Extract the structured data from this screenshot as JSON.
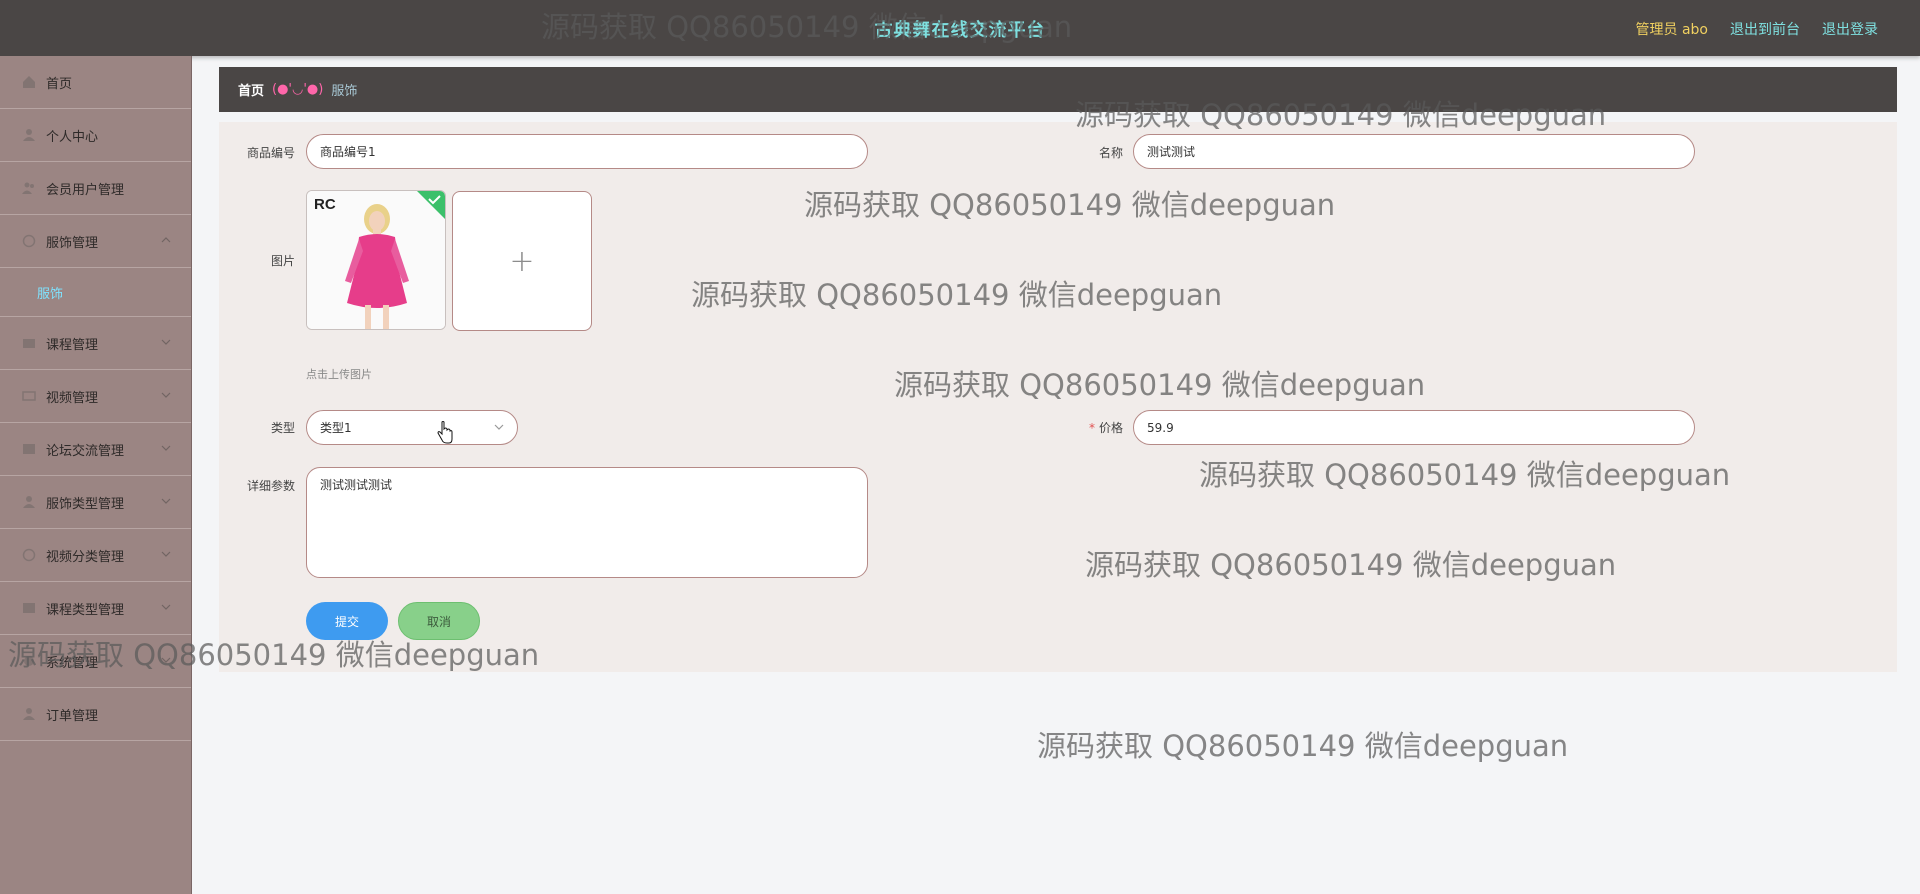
{
  "header": {
    "title": "古典舞在线交流平台",
    "admin_label": "管理员 abo",
    "front_label": "退出到前台",
    "logout_label": "退出登录"
  },
  "sidebar": {
    "items": [
      {
        "label": "首页",
        "icon": "home-icon"
      },
      {
        "label": "个人中心",
        "icon": "user-icon"
      },
      {
        "label": "会员用户管理",
        "icon": "users-icon"
      },
      {
        "label": "服饰管理",
        "icon": "clothing-icon"
      },
      {
        "label": "课程管理",
        "icon": "course-icon"
      },
      {
        "label": "视频管理",
        "icon": "video-icon"
      },
      {
        "label": "论坛交流管理",
        "icon": "forum-icon"
      },
      {
        "label": "服饰类型管理",
        "icon": "tag-icon"
      },
      {
        "label": "视频分类管理",
        "icon": "category-icon"
      },
      {
        "label": "课程类型管理",
        "icon": "list-icon"
      },
      {
        "label": "系统管理",
        "icon": "settings-icon"
      },
      {
        "label": "订单管理",
        "icon": "order-icon"
      }
    ],
    "sub_item": "服饰"
  },
  "breadcrumb": {
    "home": "首页",
    "face": "(●'◡'●)",
    "current": "服饰"
  },
  "form": {
    "code_label": "商品编号",
    "code_value": "商品编号1",
    "name_label": "名称",
    "name_value": "测试测试",
    "image_label": "图片",
    "upload_plus": "+",
    "upload_hint": "点击上传图片",
    "thumb_brand": "RC",
    "type_label": "类型",
    "type_value": "类型1",
    "price_required": "*",
    "price_label": "价格",
    "price_value": "59.9",
    "detail_label": "详细参数",
    "detail_value": "测试测试测试",
    "submit_label": "提交",
    "cancel_label": "取消"
  },
  "watermark_text": "源码获取 QQ86050149 微信deepguan",
  "colors": {
    "topbar": "#4a4645",
    "sidebar": "#9b8583",
    "accent_blue": "#3e9bf0",
    "cancel_green": "#88d08a",
    "title_cyan": "#7fe0e0",
    "admin_yellow": "#f0d060",
    "sub_item": "#7fe3ff"
  }
}
